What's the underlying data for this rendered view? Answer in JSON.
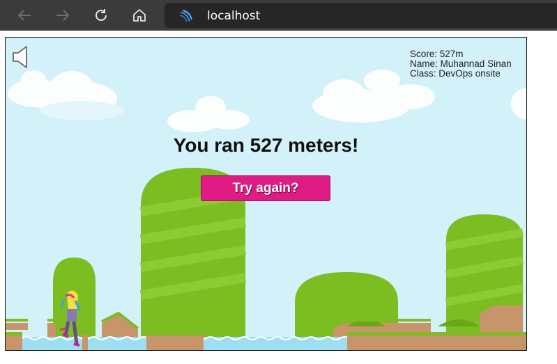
{
  "browser": {
    "url": "localhost",
    "icons": [
      "back-arrow-icon",
      "forward-arrow-icon",
      "refresh-icon",
      "home-icon",
      "site-favicon-icon"
    ]
  },
  "game": {
    "sound_icon": "speaker-icon",
    "score_line": "Score: 527m",
    "name_line": "Name: Muhannad Sinan",
    "class_line": "Class: DevOps onsite",
    "result_message": "You ran 527 meters!",
    "try_again_label": "Try again?",
    "colors": {
      "sky": "#d2f1f8",
      "hill_green": "#7cbd22",
      "button_pink": "#e01b84",
      "ground_brown": "#c8946a",
      "water": "#9ddff0"
    }
  }
}
